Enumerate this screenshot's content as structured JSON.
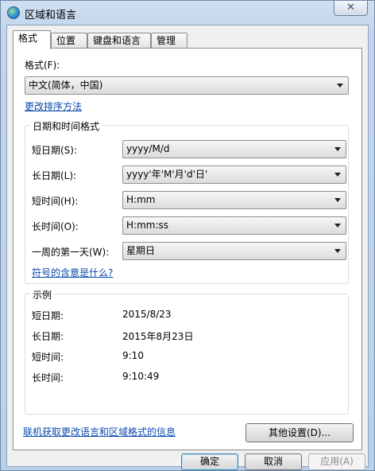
{
  "window": {
    "title": "区域和语言",
    "close_label": "✕"
  },
  "tabs": [
    {
      "label": "格式"
    },
    {
      "label": "位置"
    },
    {
      "label": "键盘和语言"
    },
    {
      "label": "管理"
    }
  ],
  "format": {
    "label": "格式(F):",
    "selected": "中文(简体，中国)",
    "change_sort_link": "更改排序方法"
  },
  "datetime_group": {
    "title": "日期和时间格式",
    "short_date_label": "短日期(S):",
    "short_date_value": "yyyy/M/d",
    "long_date_label": "长日期(L):",
    "long_date_value": "yyyy'年'M'月'd'日'",
    "short_time_label": "短时间(H):",
    "short_time_value": "H:mm",
    "long_time_label": "长时间(O):",
    "long_time_value": "H:mm:ss",
    "first_day_label": "一周的第一天(W):",
    "first_day_value": "星期日",
    "symbols_link": "符号的含意是什么?"
  },
  "examples_group": {
    "title": "示例",
    "short_date_label": "短日期:",
    "short_date_value": "2015/8/23",
    "long_date_label": "长日期:",
    "long_date_value": "2015年8月23日",
    "short_time_label": "短时间:",
    "short_time_value": "9:10",
    "long_time_label": "长时间:",
    "long_time_value": "9:10:49"
  },
  "other_settings_button": "其他设置(D)...",
  "online_link": "联机获取更改语言和区域格式的信息",
  "footer": {
    "ok_label": "确定",
    "cancel_label": "取消",
    "apply_label": "应用(A)"
  }
}
